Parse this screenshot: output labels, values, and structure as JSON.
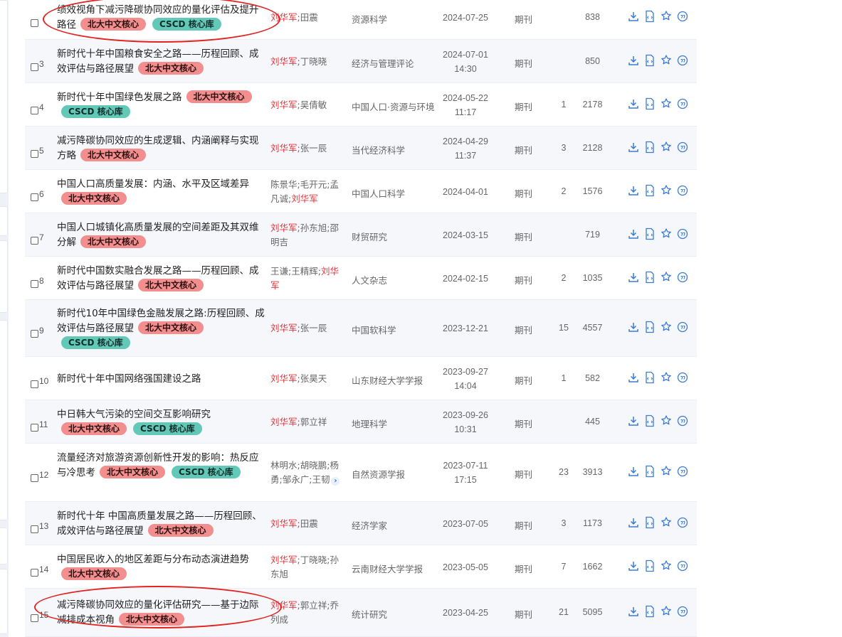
{
  "colors": {
    "accent": "#3a7bd5",
    "author_highlight": "#e0353a",
    "badge_pku": "#f28e8e",
    "badge_cscd": "#62c9b9",
    "annotation": "#e3221f"
  },
  "icons": [
    "download-icon",
    "html-read-icon",
    "favorite-star-icon",
    "quote-icon"
  ],
  "rows": [
    {
      "num": "",
      "title": "绩效视角下减污降碳协同效应的量化评估及提升路径",
      "badges": [
        "北大中文核心",
        "CSCD 核心库"
      ],
      "authors": [
        {
          "name": "刘华军",
          "hl": true
        },
        {
          "name": "田震",
          "hl": false
        }
      ],
      "more": false,
      "journal": "资源科学",
      "date": "2024-07-25",
      "time": "",
      "type": "期刊",
      "cites": "",
      "downloads": "838"
    },
    {
      "num": "3",
      "title": "新时代十年中国粮食安全之路——历程回顾、成效评估与路径展望",
      "badges": [
        "北大中文核心"
      ],
      "authors": [
        {
          "name": "刘华军",
          "hl": true
        },
        {
          "name": "丁晓晓",
          "hl": false
        }
      ],
      "more": false,
      "journal": "经济与管理评论",
      "date": "2024-07-01",
      "time": "14:30",
      "type": "期刊",
      "cites": "",
      "downloads": "850"
    },
    {
      "num": "4",
      "title": "新时代十年中国绿色发展之路",
      "badges": [
        "北大中文核心",
        "CSCD 核心库"
      ],
      "authors": [
        {
          "name": "刘华军",
          "hl": true
        },
        {
          "name": "吴倩敏",
          "hl": false
        }
      ],
      "more": false,
      "journal": "中国人口·资源与环境",
      "date": "2024-05-22",
      "time": "11:17",
      "type": "期刊",
      "cites": "1",
      "downloads": "2178"
    },
    {
      "num": "5",
      "title": "减污降碳协同效应的生成逻辑、内涵阐释与实现方略",
      "badges": [
        "北大中文核心"
      ],
      "authors": [
        {
          "name": "刘华军",
          "hl": true
        },
        {
          "name": "张一辰",
          "hl": false
        }
      ],
      "more": false,
      "journal": "当代经济科学",
      "date": "2024-04-29",
      "time": "11:37",
      "type": "期刊",
      "cites": "3",
      "downloads": "2128"
    },
    {
      "num": "6",
      "title": "中国人口高质量发展：内涵、水平及区域差异",
      "badges": [
        "北大中文核心"
      ],
      "authors": [
        {
          "name": "陈景华",
          "hl": false
        },
        {
          "name": "毛开元",
          "hl": false
        },
        {
          "name": "孟凡诚",
          "hl": false
        },
        {
          "name": "刘华军",
          "hl": true
        }
      ],
      "more": false,
      "journal": "中国人口科学",
      "date": "2024-04-01",
      "time": "",
      "type": "期刊",
      "cites": "2",
      "downloads": "1576"
    },
    {
      "num": "7",
      "title": "中国人口城镇化高质量发展的空间差距及其双维分解",
      "badges": [
        "北大中文核心"
      ],
      "authors": [
        {
          "name": "刘华军",
          "hl": true
        },
        {
          "name": "孙东旭",
          "hl": false
        },
        {
          "name": "邵明吉",
          "hl": false
        }
      ],
      "more": false,
      "journal": "财贸研究",
      "date": "2024-03-15",
      "time": "",
      "type": "期刊",
      "cites": "",
      "downloads": "719"
    },
    {
      "num": "8",
      "title": "新时代中国数实融合发展之路——历程回顾、成效评估与路径展望",
      "badges": [
        "北大中文核心"
      ],
      "authors": [
        {
          "name": "王谦",
          "hl": false
        },
        {
          "name": "王精辉",
          "hl": false
        },
        {
          "name": "刘华军",
          "hl": true
        }
      ],
      "more": false,
      "journal": "人文杂志",
      "date": "2024-02-15",
      "time": "",
      "type": "期刊",
      "cites": "2",
      "downloads": "1035"
    },
    {
      "num": "9",
      "title": "新时代10年中国绿色金融发展之路:历程回顾、成效评估与路径展望",
      "badges": [
        "北大中文核心",
        "CSCD 核心库"
      ],
      "authors": [
        {
          "name": "刘华军",
          "hl": true
        },
        {
          "name": "张一辰",
          "hl": false
        }
      ],
      "more": false,
      "journal": "中国软科学",
      "date": "2023-12-21",
      "time": "",
      "type": "期刊",
      "cites": "15",
      "downloads": "4557"
    },
    {
      "num": "10",
      "title": "新时代十年中国网络强国建设之路",
      "badges": [],
      "authors": [
        {
          "name": "刘华军",
          "hl": true
        },
        {
          "name": "张昊天",
          "hl": false
        }
      ],
      "more": false,
      "journal": "山东财经大学学报",
      "date": "2023-09-27",
      "time": "14:04",
      "type": "期刊",
      "cites": "1",
      "downloads": "582"
    },
    {
      "num": "11",
      "title": "中日韩大气污染的空间交互影响研究",
      "badges": [
        "北大中文核心",
        "CSCD 核心库"
      ],
      "authors": [
        {
          "name": "刘华军",
          "hl": true
        },
        {
          "name": "郭立祥",
          "hl": false
        }
      ],
      "more": false,
      "journal": "地理科学",
      "date": "2023-09-26",
      "time": "10:31",
      "type": "期刊",
      "cites": "",
      "downloads": "445"
    },
    {
      "num": "12",
      "title": "流量经济对旅游资源创新性开发的影响：热反应与冷思考",
      "badges": [
        "北大中文核心",
        "CSCD 核心库"
      ],
      "authors": [
        {
          "name": "林明水",
          "hl": false
        },
        {
          "name": "胡晓鹏",
          "hl": false
        },
        {
          "name": "杨勇",
          "hl": false
        },
        {
          "name": "邹永广",
          "hl": false
        },
        {
          "name": "王韧",
          "hl": false
        }
      ],
      "more": true,
      "journal": "自然资源学报",
      "date": "2023-07-11",
      "time": "17:15",
      "type": "期刊",
      "cites": "23",
      "downloads": "3913"
    },
    {
      "num": "13",
      "title": "新时代十年 中国高质量发展之路——历程回顾、成效评估与路径展望",
      "badges": [
        "北大中文核心"
      ],
      "authors": [
        {
          "name": "刘华军",
          "hl": true
        },
        {
          "name": "田震",
          "hl": false
        }
      ],
      "more": false,
      "journal": "经济学家",
      "date": "2023-07-05",
      "time": "",
      "type": "期刊",
      "cites": "3",
      "downloads": "1173"
    },
    {
      "num": "14",
      "title": "中国居民收入的地区差距与分布动态演进趋势",
      "badges": [
        "北大中文核心"
      ],
      "authors": [
        {
          "name": "刘华军",
          "hl": true
        },
        {
          "name": "丁晓晓",
          "hl": false
        },
        {
          "name": "孙东旭",
          "hl": false
        }
      ],
      "more": false,
      "journal": "云南财经大学学报",
      "date": "2023-05-05",
      "time": "",
      "type": "期刊",
      "cites": "7",
      "downloads": "1662"
    },
    {
      "num": "15",
      "title": "减污降碳协同效应的量化评估研究——基于边际减排成本视角",
      "badges": [
        "北大中文核心"
      ],
      "authors": [
        {
          "name": "刘华军",
          "hl": true
        },
        {
          "name": "郭立祥",
          "hl": false
        },
        {
          "name": "乔列成",
          "hl": false
        }
      ],
      "more": false,
      "journal": "统计研究",
      "date": "2023-04-25",
      "time": "",
      "type": "期刊",
      "cites": "21",
      "downloads": "5095"
    }
  ]
}
